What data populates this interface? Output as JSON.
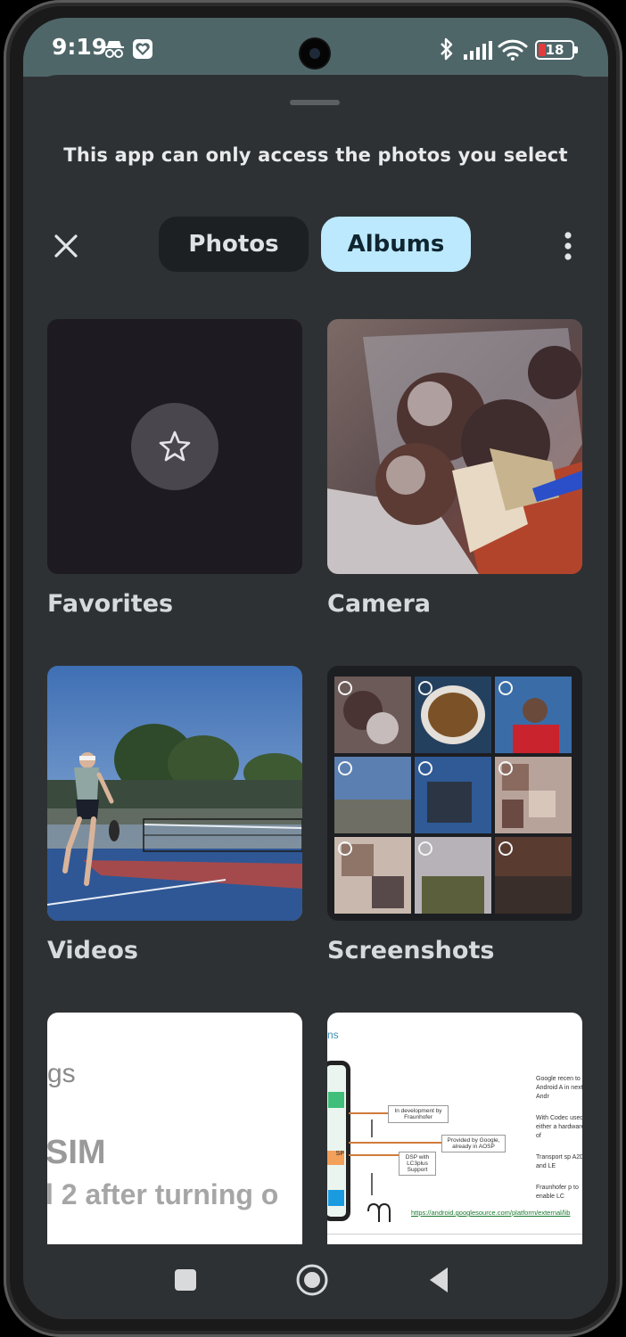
{
  "status_bar": {
    "time": "9:19",
    "battery": "18"
  },
  "sheet": {
    "banner": "This app can only access the photos you select"
  },
  "tabs": {
    "photos": "Photos",
    "albums": "Albums",
    "selected": "Albums"
  },
  "albums": [
    {
      "label": "Favorites",
      "icon": "star-icon"
    },
    {
      "label": "Camera"
    },
    {
      "label": "Videos"
    },
    {
      "label": "Screenshots"
    },
    {
      "label": ""
    },
    {
      "label": ""
    }
  ],
  "album5_preview": {
    "line1": "gs",
    "line2": "SIM",
    "line3": "l 2 after turning o"
  },
  "album6_preview": {
    "heading": "ns",
    "box1": "In development by Fraunhofer",
    "box2": "Provided by Google, already in AOSP",
    "box3": "DSP with LC3plus Support",
    "chip": "SP",
    "bullets": [
      "Google recen to Android A in next Andr",
      "With Codec used either a hardware-of",
      "Transport sp A2DP and LE",
      "Fraunhofer p to enable LC"
    ],
    "link": "https://android.googlesource.com/platform/external/lib"
  },
  "colors": {
    "status_bar": "#4f6669",
    "sheet": "#2e3133",
    "tab_selected": "#bce9fd",
    "tab_unselected": "#1d2022"
  }
}
